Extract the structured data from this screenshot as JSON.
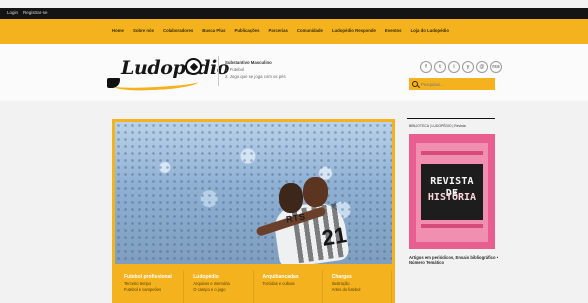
{
  "top_bar": {
    "login": "Login",
    "register": "Registrar-se"
  },
  "nav_items": [
    "Home",
    "Sobre nós",
    "Colaboradores",
    "Busca Plus",
    "Publicações",
    "Parcerias",
    "Comunidade",
    "Ludopédio Responde",
    "Eventos",
    "Loja do Ludopédio"
  ],
  "header": {
    "logo_text": "Ludopédio",
    "subtitle_1": "Substantivo Masculino",
    "subtitle_2": "1. Futebol",
    "subtitle_3": "2. Jogo que se joga com os pés",
    "social_icons": [
      "f",
      "t",
      "i",
      "y",
      "@",
      "rss"
    ],
    "search_placeholder": "Pesquisar...",
    "search_icon": "search-icon"
  },
  "hero": {
    "shirt_name": "RTS",
    "shirt_number": "21"
  },
  "categories": [
    {
      "title": "Futebol profissional",
      "line1": "Terceiro tempo",
      "line2": "Futebol e campeões"
    },
    {
      "title": "Ludopédio",
      "line1": "Arquivos e memória",
      "line2": "O campo e o jogo"
    },
    {
      "title": "Arquibancadas",
      "line1": "Torcidas e cultura",
      "line2": ""
    },
    {
      "title": "Charges",
      "line1": "Ilustração",
      "line2": "Artes do futebol"
    }
  ],
  "sidebar": {
    "label": "BIBLIOTECA | LUDOPÉDIO | Revista",
    "magazine_title_1": "REVISTA DE",
    "magazine_title_2": "HISTÓRIA",
    "caption": "Artigos em periódicos, Ensaio bibliográfico • Número Temático"
  }
}
